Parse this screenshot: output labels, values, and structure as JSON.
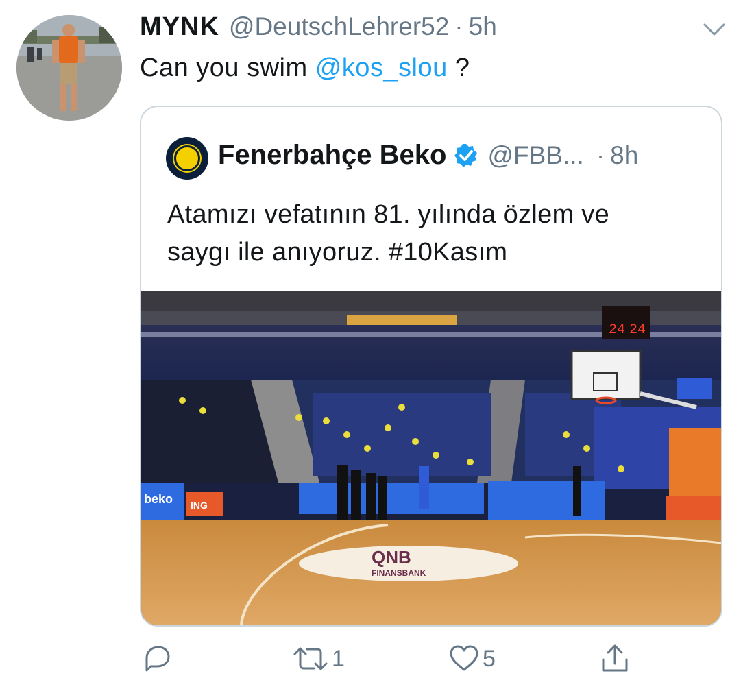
{
  "tweet": {
    "display_name": "MYNK",
    "handle": "@DeutschLehrer52",
    "separator": "·",
    "time": "5h",
    "text_before": "Can you swim ",
    "mention": "@kos_slou",
    "text_after": " ?"
  },
  "quote": {
    "display_name": "Fenerbahçe Beko",
    "handle": "@FBB...",
    "separator": "·",
    "time": "8h",
    "text_lines": [
      "Atamızı vefatının 81. yılında özlem ve",
      "saygı ile anıyoruz. #10Kasım"
    ]
  },
  "media": {
    "scoreboard_left": "24",
    "scoreboard_right": "24",
    "board_text": "beko",
    "sponsor": "ING",
    "court_logo": "QNB",
    "court_logo_sub": "FINANSBANK"
  },
  "actions": {
    "reply_count": "",
    "retweet_count": "1",
    "like_count": "5"
  },
  "colors": {
    "link": "#1da1f2",
    "secondary_text": "#657786",
    "border": "#ccd6dd"
  }
}
